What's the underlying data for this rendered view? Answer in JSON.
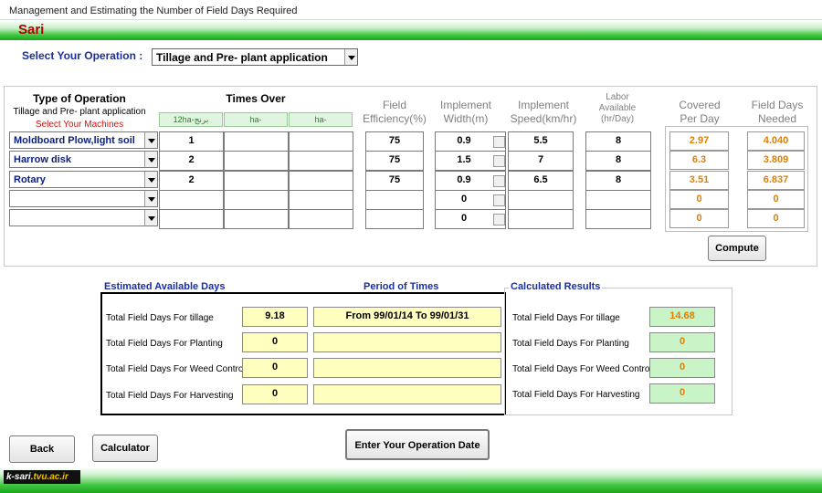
{
  "window": {
    "title": "Management and Estimating the Number of Field Days Required"
  },
  "header": {
    "location": "Sari"
  },
  "operation_select": {
    "label": "Select Your Operation :",
    "value": "Tillage and Pre- plant application"
  },
  "table": {
    "type_header": "Type of Operation",
    "type_sub": "Tillage and Pre- plant application",
    "type_hint": "Select Your Machines",
    "times_over_header": "Times Over",
    "times_over_cols": [
      "12ha-برنج",
      "ha-",
      "ha-"
    ],
    "field_eff_header": "Field",
    "field_eff_header2": "Efficiency(%)",
    "impl_width_header": "Implement",
    "impl_width_header2": "Width(m)",
    "impl_speed_header": "Implement",
    "impl_speed_header2": "Speed(km/hr)",
    "labor_header1": "Labor",
    "labor_header2": "Available",
    "labor_header3": "(hr/Day)",
    "covered_header": "Covered",
    "covered_header2": "Per Day",
    "fielddays_header": "Field Days",
    "fielddays_header2": "Needed",
    "rows": [
      {
        "machine": "Moldboard Plow,light soil",
        "times": [
          "1",
          "",
          ""
        ],
        "eff": "75",
        "width": "0.9",
        "speed": "5.5",
        "labor": "8",
        "covered": "2.97",
        "days": "4.040"
      },
      {
        "machine": "Harrow disk",
        "times": [
          "2",
          "",
          ""
        ],
        "eff": "75",
        "width": "1.5",
        "speed": "7",
        "labor": "8",
        "covered": "6.3",
        "days": "3.809"
      },
      {
        "machine": "Rotary",
        "times": [
          "2",
          "",
          ""
        ],
        "eff": "75",
        "width": "0.9",
        "speed": "6.5",
        "labor": "8",
        "covered": "3.51",
        "days": "6.837"
      },
      {
        "machine": "",
        "times": [
          "",
          "",
          ""
        ],
        "eff": "",
        "width": "0",
        "speed": "",
        "labor": "",
        "covered": "0",
        "days": "0"
      },
      {
        "machine": "",
        "times": [
          "",
          "",
          ""
        ],
        "eff": "",
        "width": "0",
        "speed": "",
        "labor": "",
        "covered": "0",
        "days": "0"
      }
    ]
  },
  "buttons": {
    "compute": "Compute",
    "back": "Back",
    "calculator": "Calculator",
    "enter_date": "Enter Your Operation Date"
  },
  "estimated": {
    "title": "Estimated Available Days",
    "period_title": "Period  of  Times",
    "rows": [
      {
        "label": "Total Field Days For tillage",
        "value": "9.18",
        "period": "From  99/01/14  To  99/01/31"
      },
      {
        "label": "Total Field Days For Planting",
        "value": "0",
        "period": ""
      },
      {
        "label": "Total Field Days For Weed Control",
        "value": "0",
        "period": ""
      },
      {
        "label": "Total Field Days For Harvesting",
        "value": "0",
        "period": ""
      }
    ]
  },
  "calculated": {
    "title": "Calculated Results",
    "rows": [
      {
        "label": "Total Field Days For tillage",
        "value": "14.68"
      },
      {
        "label": "Total Field Days For Planting",
        "value": "0"
      },
      {
        "label": "Total Field Days For Weed Control",
        "value": "0"
      },
      {
        "label": "Total Field Days For Harvesting",
        "value": "0"
      }
    ]
  },
  "footer": {
    "logo_left": "k-sari",
    "logo_right": ".tvu.ac.ir"
  },
  "colors": {
    "accent_green": "#1aa51a",
    "title_red": "#b00000",
    "label_blue": "#1a2ea0",
    "value_orange": "#e07f00"
  }
}
